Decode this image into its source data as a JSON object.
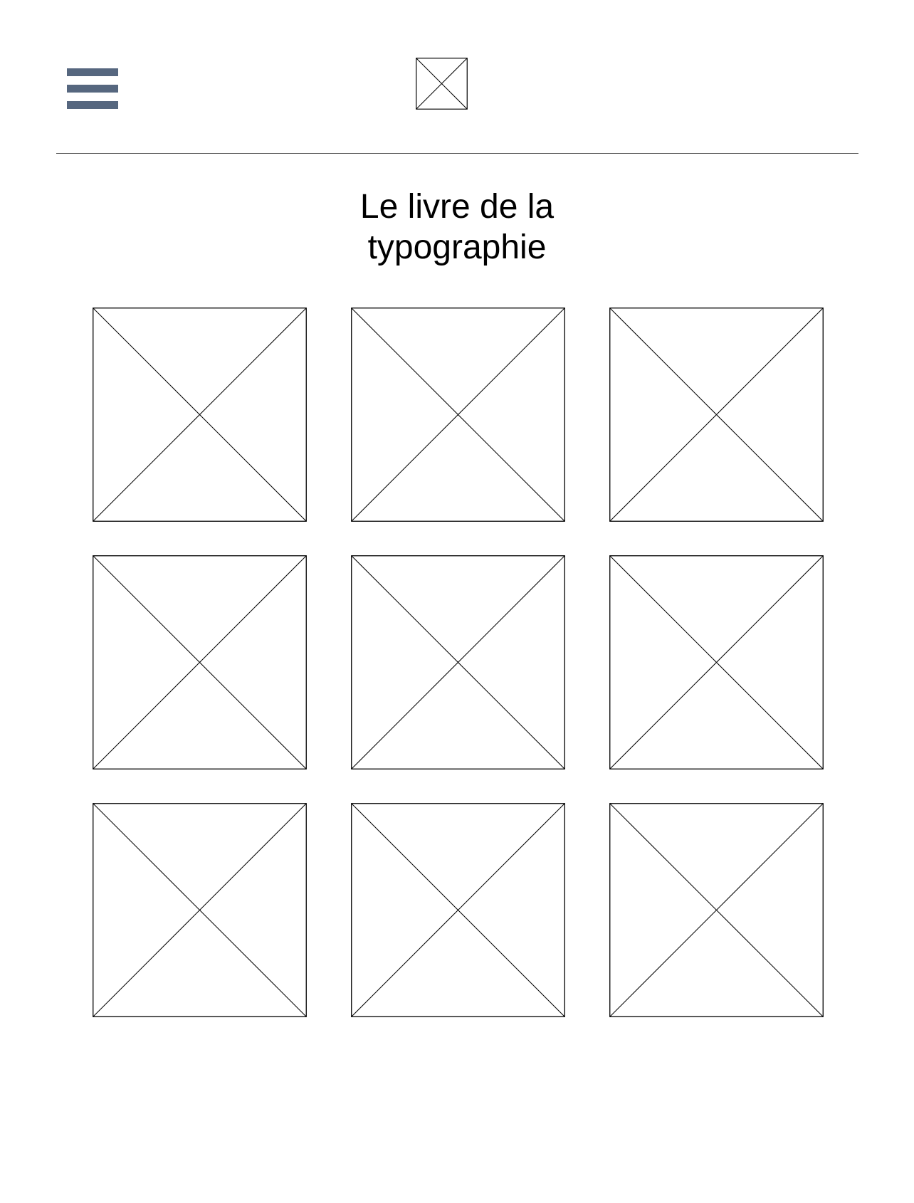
{
  "header": {
    "menu_icon": "hamburger-menu-icon",
    "menu_color": "#56677f",
    "logo_icon": "image-placeholder-icon"
  },
  "title": {
    "line1": "Le livre de la",
    "line2": "typographie"
  },
  "gallery": {
    "item_icon": "image-placeholder-icon",
    "rows": 3,
    "columns": 3,
    "item_count": 9
  }
}
